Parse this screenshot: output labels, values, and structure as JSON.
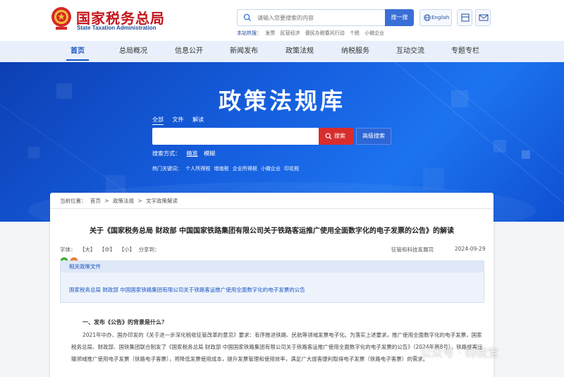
{
  "header": {
    "logo_cn": "国家税务总局",
    "logo_en": "State Taxation Administration",
    "search_placeholder": "请输入您要搜索的内容",
    "search_button": "搜一搜",
    "lang_button": "English",
    "hot_label": "本站热搜：",
    "hot_items": [
      "发票",
      "民营经济",
      "便民办税春风行动",
      "个税",
      "小微企业"
    ]
  },
  "nav": {
    "items": [
      "首页",
      "总局概况",
      "信息公开",
      "新闻发布",
      "政策法规",
      "纳税服务",
      "互动交流",
      "专题专栏"
    ],
    "active": "首页"
  },
  "banner": {
    "title": "政策法规库",
    "scope_tabs": [
      "全部",
      "文件",
      "解读"
    ],
    "search_button": "搜索",
    "advanced_button": "高级搜索",
    "search_mode_label": "搜索方式：",
    "search_modes": [
      "精准",
      "模糊"
    ],
    "hot_kw_label": "热门关键词：",
    "hot_keywords": [
      "个人所得税",
      "增值税",
      "企业所得税",
      "小微企业",
      "印花税"
    ]
  },
  "article": {
    "breadcrumb": [
      "当前位置：",
      "首页",
      ">",
      "政策法规",
      ">",
      "文字政策解读"
    ],
    "title": "关于《国家税务总局 财政部 中国国家铁路集团有限公司关于铁路客运推广使用全面数字化的电子发票的公告》的解读",
    "font_label": "字体：",
    "font_sizes": [
      "【大】",
      "【中】",
      "【小】"
    ],
    "share_label": "分享到：",
    "source": "征管和科技发展司",
    "date": "2024-09-29",
    "related_head": "相关政策文件",
    "related_link": "国家税务总局 财政部 中国国家铁路集团有限公司关于铁路客运推广使用全面数字化的电子发票的公告",
    "section_head": "一、发布《公告》的背景是什么？",
    "paragraph": "2021年中办、国办印发的《关于进一步深化税收征管改革的意见》要求：有序推进铁路、民航等领域发票电子化。为落实上述要求，推广使用全面数字化的电子发票，国家税务总局、财政部、国铁集团联合制发了《国家税务总局 财政部 中国国家铁路集团有限公司关于铁路客运推广使用全面数字化的电子发票的公告》（2024年第8号）。铁路旅客运输领域推广使用电子发票（铁路电子客票），将降低发票使用成本，提升发票管理和使用效率，满足广大旅客便利取得电子发票（铁路电子客票）的需求。"
  },
  "watermark": "公众号 · 钧税宝",
  "colors": {
    "brand_red": "#c4161c",
    "nav_active": "#1a55c4",
    "banner_blue": "#1660e0",
    "search_red": "#d92d2d"
  }
}
